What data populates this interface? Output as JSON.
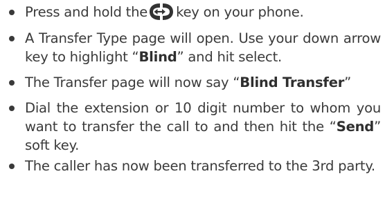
{
  "steps": [
    {
      "before_icon": "Press and hold the",
      "icon": "transfer-key-icon",
      "after_icon": "key on your phone."
    },
    {
      "before": "A Transfer Type page will open.  Use your down arrow key to highlight “",
      "bold": "Blind",
      "after": "” and hit select."
    },
    {
      "before": "The Transfer page will now say “",
      "bold": "Blind Transfer",
      "after": "”"
    },
    {
      "before": "Dial the extension or 10 digit number to whom you want to transfer the call to and then hit the “",
      "bold": "Send",
      "after": "” soft key."
    },
    {
      "text": "The caller has now been transferred to the 3rd party."
    }
  ],
  "colors": {
    "text": "#3a3a3a",
    "icon": "#333333"
  }
}
